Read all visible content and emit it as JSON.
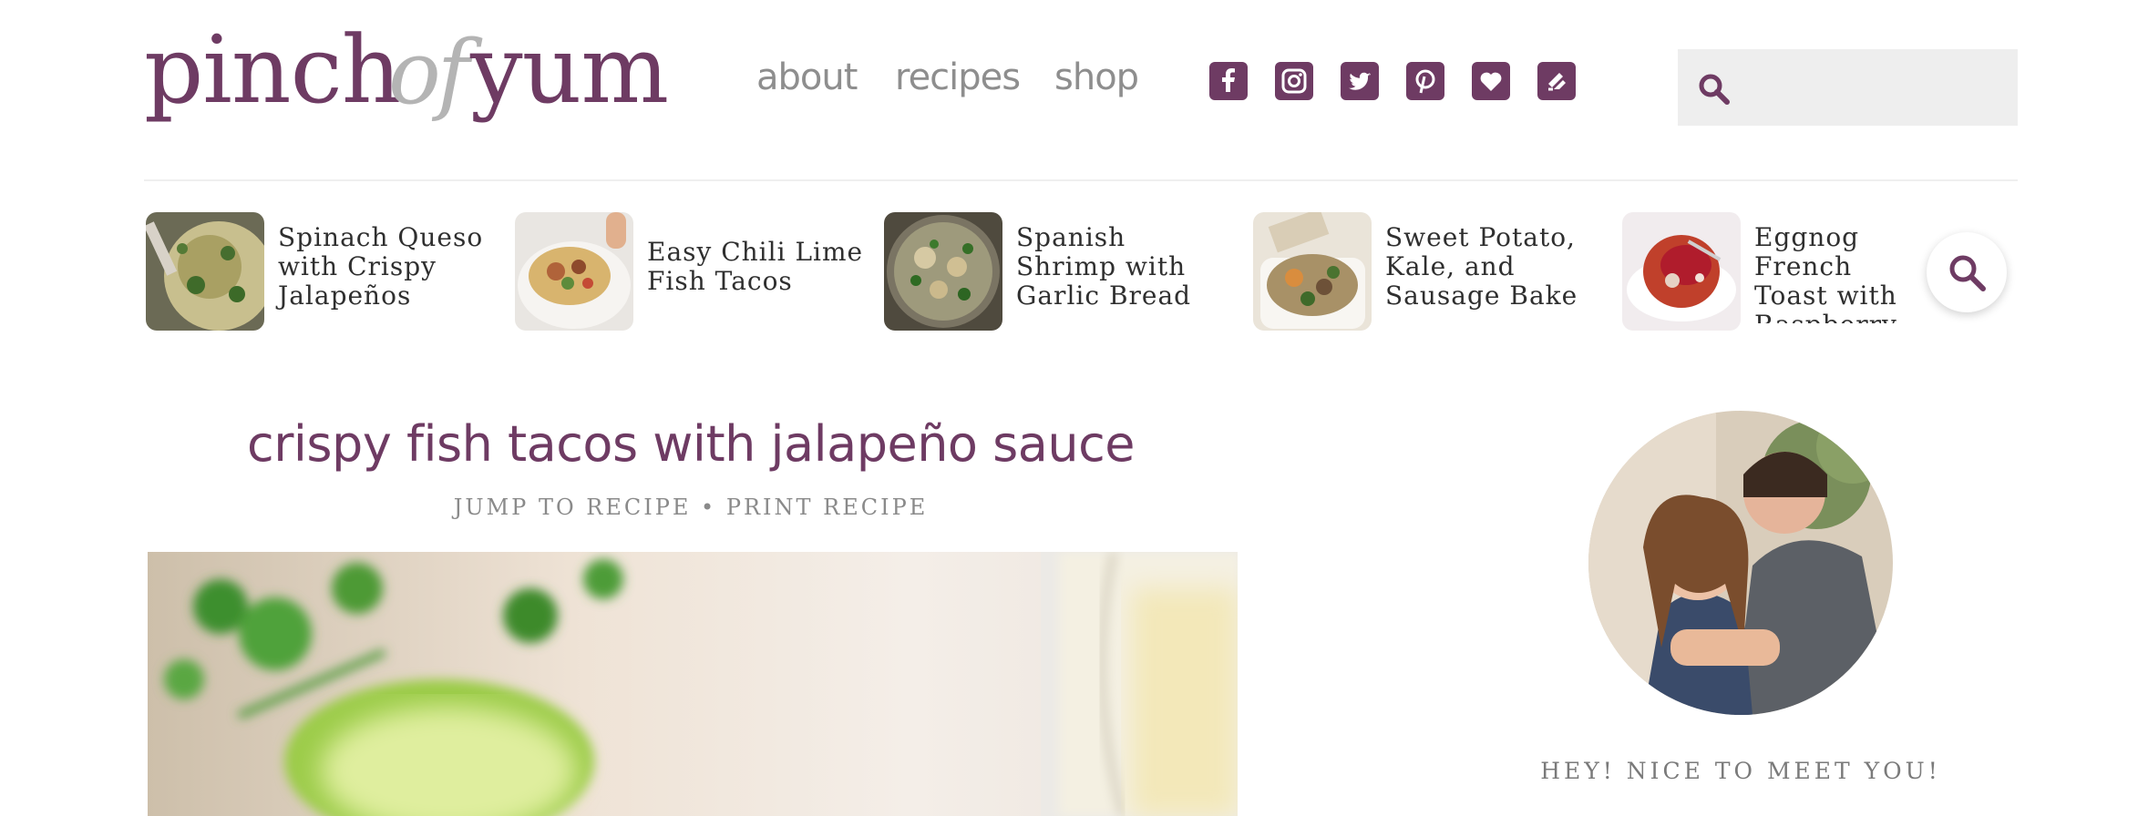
{
  "header": {
    "logo": {
      "part1": "pinch",
      "part2": "of",
      "part3": "yum"
    },
    "nav": [
      {
        "label": "about"
      },
      {
        "label": "recipes"
      },
      {
        "label": "shop"
      }
    ],
    "social_icons": [
      "facebook-icon",
      "instagram-icon",
      "twitter-icon",
      "pinterest-icon",
      "bloglovin-heart-icon",
      "feedly-icon"
    ],
    "search": {
      "placeholder": "",
      "value": ""
    }
  },
  "carousel": {
    "items": [
      {
        "title": "Spinach Queso with Crispy Jalapeños"
      },
      {
        "title": "Easy Chili Lime Fish Tacos"
      },
      {
        "title": "Spanish Shrimp with Garlic Bread"
      },
      {
        "title": "Sweet Potato, Kale, and Sausage Bake"
      },
      {
        "title": "Eggnog French Toast with Raspberry"
      }
    ]
  },
  "post": {
    "title": "crispy fish tacos with jalapeño sauce",
    "jump_label": "JUMP TO RECIPE",
    "separator": "•",
    "print_label": "PRINT RECIPE"
  },
  "sidebar": {
    "greeting": "HEY! NICE TO MEET YOU!"
  },
  "colors": {
    "brand": "#6e3b63",
    "nav_text": "#8e8e8e",
    "search_bg": "#eeeeee"
  }
}
